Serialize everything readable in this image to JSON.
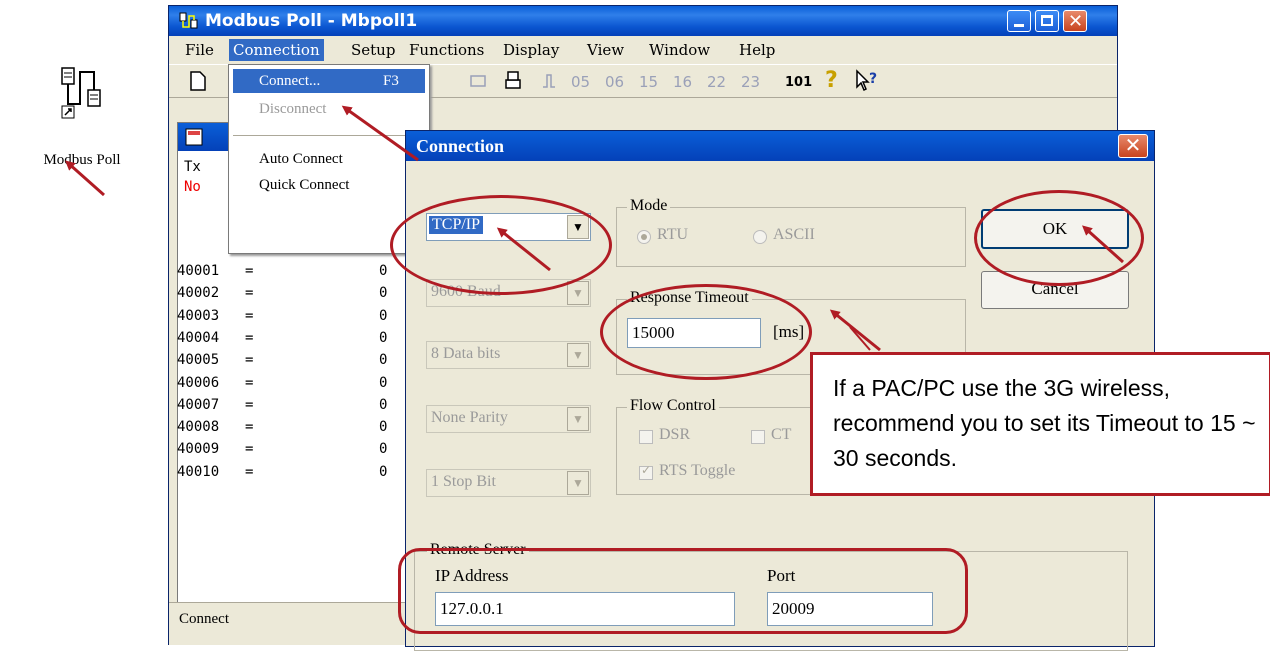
{
  "desktop_icon": {
    "label": "Modbus Poll"
  },
  "main_window": {
    "title": "Modbus Poll - Mbpoll1",
    "menu": [
      "File",
      "Connection",
      "Setup",
      "Functions",
      "Display",
      "View",
      "Window",
      "Help"
    ],
    "toolbar_codes": [
      "05",
      "06",
      "15",
      "16",
      "22",
      "23",
      "101"
    ],
    "status": "Connect"
  },
  "connection_menu": {
    "items": [
      {
        "label": "Connect...",
        "shortcut": "F3"
      },
      {
        "label": "Disconnect"
      },
      {
        "label": "Auto Connect"
      },
      {
        "label": "Quick Connect"
      }
    ]
  },
  "child_window": {
    "tx_label": "Tx",
    "status_text": "No",
    "registers": [
      {
        "addr": "40001",
        "eq": "=",
        "value": "0"
      },
      {
        "addr": "40002",
        "eq": "=",
        "value": "0"
      },
      {
        "addr": "40003",
        "eq": "=",
        "value": "0"
      },
      {
        "addr": "40004",
        "eq": "=",
        "value": "0"
      },
      {
        "addr": "40005",
        "eq": "=",
        "value": "0"
      },
      {
        "addr": "40006",
        "eq": "=",
        "value": "0"
      },
      {
        "addr": "40007",
        "eq": "=",
        "value": "0"
      },
      {
        "addr": "40008",
        "eq": "=",
        "value": "0"
      },
      {
        "addr": "40009",
        "eq": "=",
        "value": "0"
      },
      {
        "addr": "40010",
        "eq": "=",
        "value": "0"
      }
    ]
  },
  "dialog": {
    "title": "Connection",
    "connection_type": "TCP/IP",
    "baud": "9600 Baud",
    "data_bits": "8 Data bits",
    "parity": "None Parity",
    "stop_bit": "1 Stop Bit",
    "mode": {
      "label": "Mode",
      "rtu": "RTU",
      "ascii": "ASCII"
    },
    "response_timeout": {
      "label": "Response Timeout",
      "value": "15000",
      "unit": "[ms]"
    },
    "flow_control": {
      "label": "Flow Control",
      "dsr": "DSR",
      "cts": "CT",
      "rts_toggle": "RTS Toggle"
    },
    "remote_server": {
      "label": "Remote Server",
      "ip_label": "IP Address",
      "ip_value": "127.0.0.1",
      "port_label": "Port",
      "port_value": "20009"
    },
    "ok_label": "OK",
    "cancel_label": "Cancel"
  },
  "callout": {
    "text": "If a PAC/PC use the 3G wireless, recommend you to set its Timeout to 15 ~ 30  seconds."
  },
  "colors": {
    "annotation_red": "#b01c24",
    "titlebar_blue": "#0a5fd8",
    "selection_blue": "#316ac5"
  }
}
